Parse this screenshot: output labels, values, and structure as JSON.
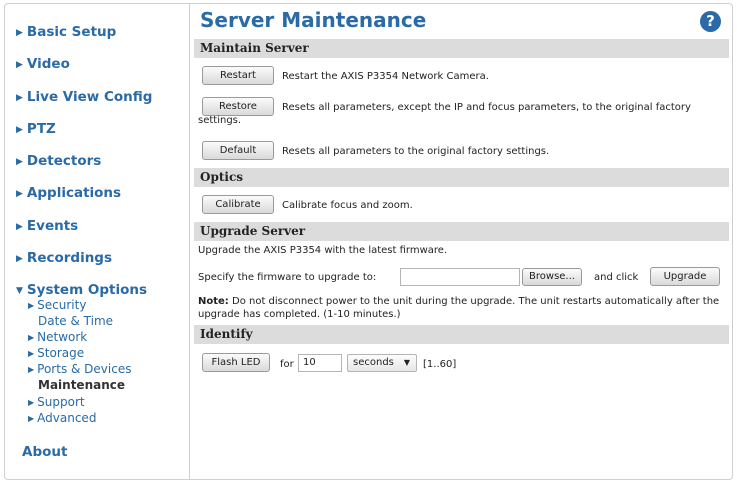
{
  "sidebar": {
    "items": [
      {
        "label": "Basic Setup"
      },
      {
        "label": "Video"
      },
      {
        "label": "Live View Config"
      },
      {
        "label": "PTZ"
      },
      {
        "label": "Detectors"
      },
      {
        "label": "Applications"
      },
      {
        "label": "Events"
      },
      {
        "label": "Recordings"
      },
      {
        "label": "System Options"
      },
      {
        "label": "About"
      }
    ],
    "system_options_sub": [
      {
        "label": "Security"
      },
      {
        "label": "Date & Time"
      },
      {
        "label": "Network"
      },
      {
        "label": "Storage"
      },
      {
        "label": "Ports & Devices"
      },
      {
        "label": "Maintenance"
      },
      {
        "label": "Support"
      },
      {
        "label": "Advanced"
      }
    ]
  },
  "main": {
    "title": "Server Maintenance",
    "help_icon": "?",
    "maintain": {
      "heading": "Maintain Server",
      "restart_label": "Restart",
      "restart_desc": "Restart the AXIS P3354 Network Camera.",
      "restore_label": "Restore",
      "restore_desc": "Resets all parameters, except the IP and focus parameters, to the original factory settings.",
      "default_label": "Default",
      "default_desc": "Resets all parameters to the original factory settings."
    },
    "optics": {
      "heading": "Optics",
      "calibrate_label": "Calibrate",
      "calibrate_desc": "Calibrate focus and zoom."
    },
    "upgrade": {
      "heading": "Upgrade Server",
      "intro": "Upgrade the AXIS P3354 with the latest firmware.",
      "specify": "Specify the firmware to upgrade to:",
      "file_value": "",
      "browse_label": "Browse...",
      "and_click": "and click",
      "upgrade_label": "Upgrade",
      "note_bold": "Note:",
      "note_text": " Do not disconnect power to the unit during the upgrade. The unit restarts automatically after the upgrade has completed. (1-10 minutes.)"
    },
    "identify": {
      "heading": "Identify",
      "flash_label": "Flash LED",
      "for_text": "for",
      "duration_value": "10",
      "unit_selected": "seconds",
      "range_text": "[1..60]"
    }
  }
}
